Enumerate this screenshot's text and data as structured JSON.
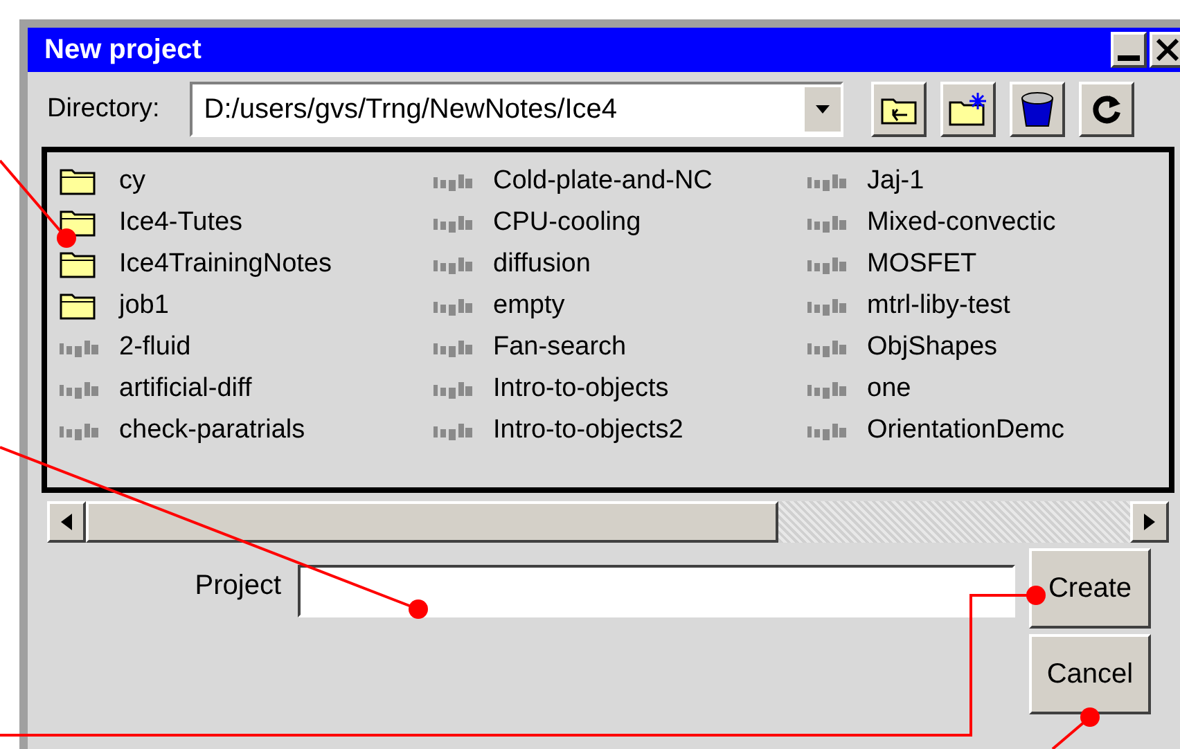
{
  "window": {
    "title": "New project"
  },
  "directory": {
    "label": "Directory:",
    "value": "D:/users/gvs/Trng/NewNotes/Ice4"
  },
  "files": [
    {
      "name": "cy",
      "kind": "folder"
    },
    {
      "name": "Ice4-Tutes",
      "kind": "folder"
    },
    {
      "name": "Ice4TrainingNotes",
      "kind": "folder"
    },
    {
      "name": "job1",
      "kind": "folder"
    },
    {
      "name": "2-fluid",
      "kind": "project"
    },
    {
      "name": "artificial-diff",
      "kind": "project"
    },
    {
      "name": "check-paratrials",
      "kind": "project"
    },
    {
      "name": "Cold-plate-and-NC",
      "kind": "project"
    },
    {
      "name": "CPU-cooling",
      "kind": "project"
    },
    {
      "name": "diffusion",
      "kind": "project"
    },
    {
      "name": "empty",
      "kind": "project"
    },
    {
      "name": "Fan-search",
      "kind": "project"
    },
    {
      "name": "Intro-to-objects",
      "kind": "project"
    },
    {
      "name": "Intro-to-objects2",
      "kind": "project"
    },
    {
      "name": "Jaj-1",
      "kind": "project"
    },
    {
      "name": "Mixed-convectic",
      "kind": "project"
    },
    {
      "name": "MOSFET",
      "kind": "project"
    },
    {
      "name": "mtrl-liby-test",
      "kind": "project"
    },
    {
      "name": "ObjShapes",
      "kind": "project"
    },
    {
      "name": "one",
      "kind": "project"
    },
    {
      "name": "OrientationDemc",
      "kind": "project"
    }
  ],
  "project": {
    "label": "Project"
  },
  "buttons": [
    "Create",
    "Cancel"
  ]
}
